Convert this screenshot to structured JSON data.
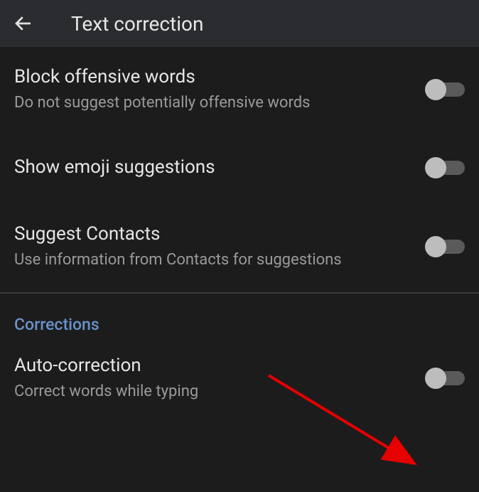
{
  "header": {
    "title": "Text correction"
  },
  "settings": [
    {
      "title": "Block offensive words",
      "subtitle": "Do not suggest potentially offensive words"
    },
    {
      "title": "Show emoji suggestions",
      "subtitle": ""
    },
    {
      "title": "Suggest Contacts",
      "subtitle": "Use information from Contacts for suggestions"
    }
  ],
  "section": {
    "label": "Corrections"
  },
  "correction_settings": [
    {
      "title": "Auto-correction",
      "subtitle": "Correct words while typing"
    }
  ]
}
